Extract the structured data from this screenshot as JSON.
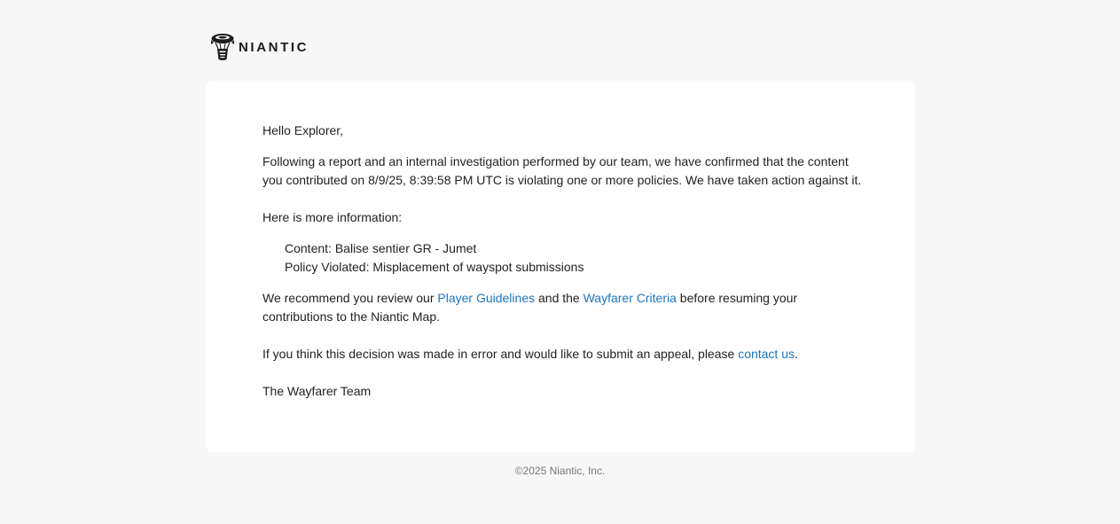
{
  "brand": {
    "name": "NIANTIC",
    "icon": "niantic-airship-icon"
  },
  "email": {
    "greeting": "Hello Explorer,",
    "intro": "Following a report and an internal investigation performed by our team, we have confirmed that the content you contributed on 8/9/25, 8:39:58 PM UTC is violating one or more policies. We have taken action against it.",
    "more_info_label": "Here is more information:",
    "details": {
      "content": "Content: Balise sentier GR - Jumet",
      "policy": "Policy Violated: Misplacement of wayspot submissions"
    },
    "recommend": {
      "before": "We recommend you review our ",
      "player_guidelines_link": "Player Guidelines",
      "middle": " and the ",
      "wayfarer_criteria_link": "Wayfarer Criteria",
      "after": " before resuming your contributions to the Niantic Map."
    },
    "appeal": {
      "before": "If you think this decision was made in error and would like to submit an appeal, please ",
      "contact_link": "contact us",
      "after": "."
    },
    "signoff": "The Wayfarer Team"
  },
  "footer": {
    "copyright": "©2025 Niantic, Inc."
  },
  "colors": {
    "background": "#f7f7f7",
    "card": "#ffffff",
    "text": "#222222",
    "link": "#1c76c4",
    "footer_text": "#777777"
  }
}
